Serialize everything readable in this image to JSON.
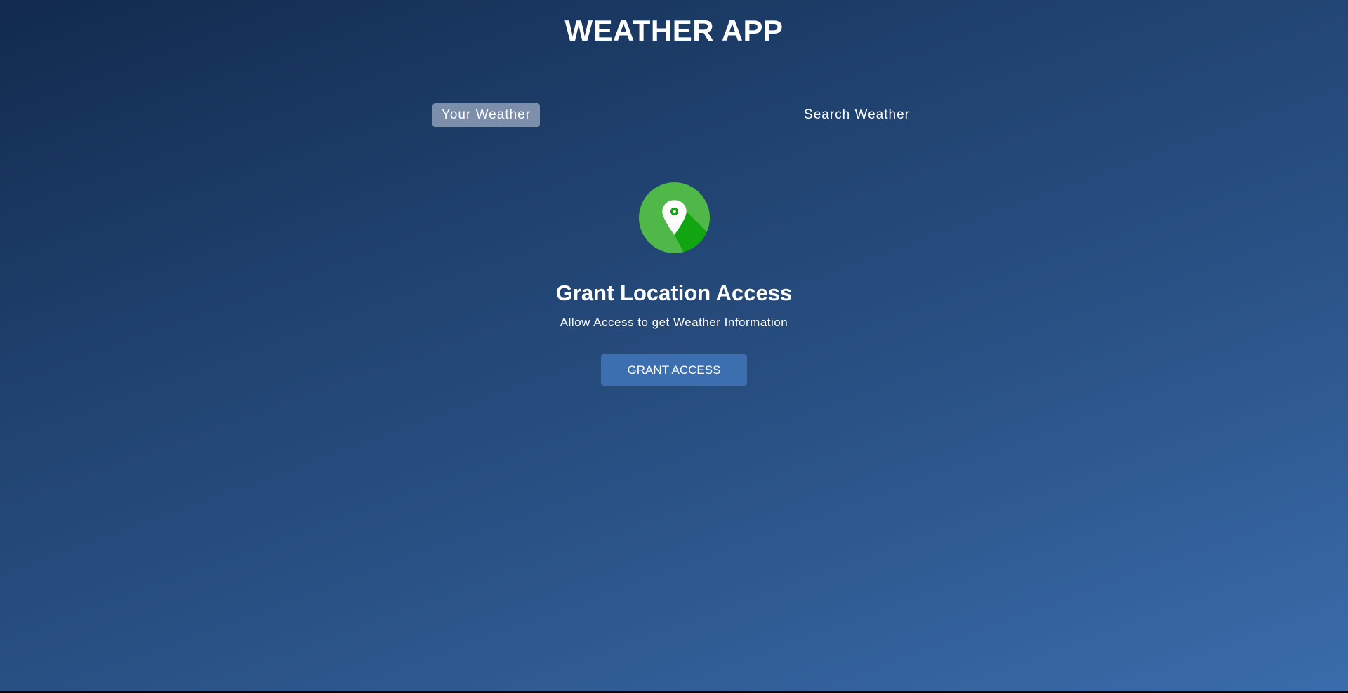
{
  "app": {
    "title": "WEATHER APP"
  },
  "tabs": [
    {
      "label": "Your Weather",
      "active": true
    },
    {
      "label": "Search Weather",
      "active": false
    }
  ],
  "grant": {
    "icon": "location-pin-icon",
    "heading": "Grant Location Access",
    "subtext": "Allow Access to get Weather Information",
    "button_label": "GRANT ACCESS"
  },
  "colors": {
    "background_start": "#112a4d",
    "background_end": "#3a6cab",
    "active_tab": "#8a9dba",
    "button": "#3c6fb0",
    "icon_circle": "#4fb848",
    "icon_shadow": "#12a512"
  }
}
